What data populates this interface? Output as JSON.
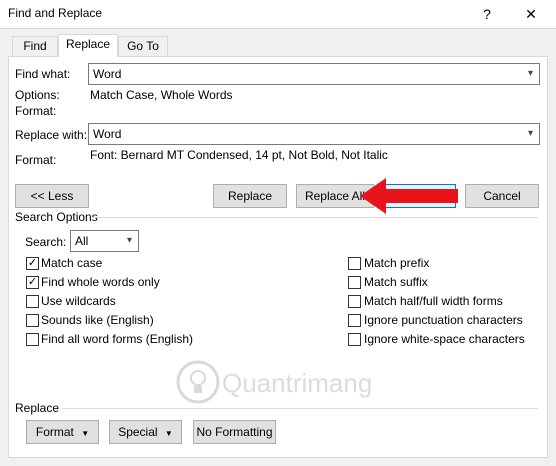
{
  "window": {
    "title": "Find and Replace",
    "help_glyph": "?",
    "close_glyph": "✕"
  },
  "tabs": [
    {
      "label": "Find"
    },
    {
      "label": "Replace"
    },
    {
      "label": "Go To"
    }
  ],
  "find": {
    "label": "Find what:",
    "value": "Word",
    "options_label": "Options:",
    "options_value": "Match Case, Whole Words",
    "format_label": "Format:"
  },
  "replace": {
    "label": "Replace with:",
    "value": "Word",
    "format_label": "Format:",
    "format_value": "Font: Bernard MT Condensed, 14 pt, Not Bold, Not Italic"
  },
  "buttons": {
    "less": "<< Less",
    "replace": "Replace",
    "replace_all": "Replace All",
    "find_next": "",
    "cancel": "Cancel"
  },
  "search_options": {
    "heading": "Search Options",
    "search_label": "Search:",
    "search_value": "All",
    "left": [
      {
        "label": "Match case",
        "checked": true
      },
      {
        "label": "Find whole words only",
        "checked": true
      },
      {
        "label": "Use wildcards",
        "checked": false
      },
      {
        "label": "Sounds like (English)",
        "checked": false
      },
      {
        "label": "Find all word forms (English)",
        "checked": false
      }
    ],
    "right": [
      {
        "label": "Match prefix",
        "checked": false
      },
      {
        "label": "Match suffix",
        "checked": false
      },
      {
        "label": "Match half/full width forms",
        "checked": false
      },
      {
        "label": "Ignore punctuation characters",
        "checked": false
      },
      {
        "label": "Ignore white-space characters",
        "checked": false
      }
    ]
  },
  "replace_section": {
    "heading": "Replace",
    "format_btn": "Format",
    "special_btn": "Special",
    "no_formatting_btn": "No Formatting"
  },
  "watermark": {
    "text": "Quantrimang"
  },
  "colors": {
    "arrow": "#e8141c",
    "focus": "#0078d7"
  }
}
